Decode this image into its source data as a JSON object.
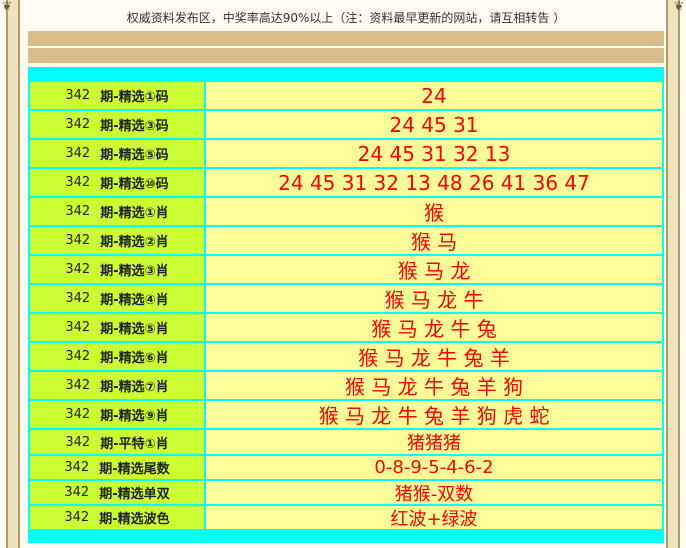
{
  "notice": "权威资料发布区，中奖率高达90%以上（注：资料最早更新的网站，请互相转告 ）",
  "corner_glyph": "❦",
  "rows": [
    {
      "issue": "342",
      "label": "期-精选①码",
      "value": "24",
      "size": 20,
      "h": 27
    },
    {
      "issue": "342",
      "label": "期-精选③码",
      "value": "24 45 31",
      "size": 20,
      "h": 27
    },
    {
      "issue": "342",
      "label": "期-精选⑤码",
      "value": "24 45 31 32 13",
      "size": 20,
      "h": 27
    },
    {
      "issue": "342",
      "label": "期-精选⑩码",
      "value": "24 45 31 32 13 48 26 41 36 47",
      "size": 20,
      "h": 27
    },
    {
      "issue": "342",
      "label": "期-精选①肖",
      "value": "猴",
      "size": 20,
      "h": 27
    },
    {
      "issue": "342",
      "label": "期-精选②肖",
      "value": "猴 马",
      "size": 20,
      "h": 27
    },
    {
      "issue": "342",
      "label": "期-精选③肖",
      "value": "猴 马 龙",
      "size": 20,
      "h": 27
    },
    {
      "issue": "342",
      "label": "期-精选④肖",
      "value": "猴 马 龙 牛",
      "size": 20,
      "h": 27
    },
    {
      "issue": "342",
      "label": "期-精选⑤肖",
      "value": "猴 马 龙 牛 兔",
      "size": 20,
      "h": 27
    },
    {
      "issue": "342",
      "label": "期-精选⑥肖",
      "value": "猴 马 龙 牛 兔 羊",
      "size": 20,
      "h": 27
    },
    {
      "issue": "342",
      "label": "期-精选⑦肖",
      "value": "猴 马 龙 牛 兔 羊 狗",
      "size": 20,
      "h": 27
    },
    {
      "issue": "342",
      "label": "期-精选⑨肖",
      "value": "猴 马 龙 牛 兔 羊 狗 虎 蛇",
      "size": 20,
      "h": 27
    },
    {
      "issue": "342",
      "label": "期-平特①肖",
      "value": "猪猪猪",
      "size": 18,
      "h": 24
    },
    {
      "issue": "342",
      "label": "期-精选尾数",
      "value": "0-8-9-5-4-6-2",
      "size": 18,
      "h": 23
    },
    {
      "issue": "342",
      "label": "期-精选单双",
      "value": "猪猴-双数",
      "size": 18,
      "h": 23
    },
    {
      "issue": "342",
      "label": "期-精选波色",
      "value": "红波+绿波",
      "size": 18,
      "h": 23
    }
  ]
}
